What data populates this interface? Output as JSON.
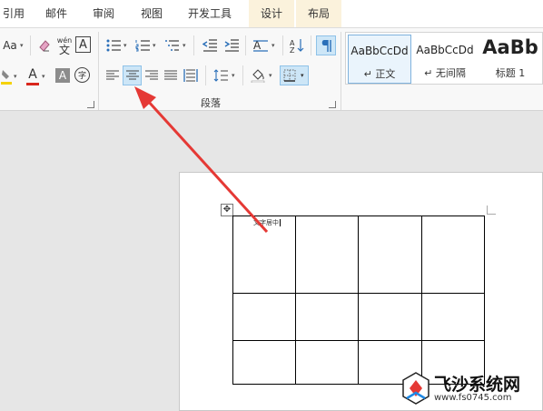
{
  "tabs": [
    {
      "label": "引用"
    },
    {
      "label": "邮件"
    },
    {
      "label": "审阅"
    },
    {
      "label": "视图"
    },
    {
      "label": "开发工具"
    },
    {
      "label": "设计"
    },
    {
      "label": "布局"
    }
  ],
  "ribbon": {
    "font": {
      "change_case_label": "Aa",
      "phonetic_top": "wén",
      "phonetic_bottom": "文",
      "border_char": "A",
      "font_color_label": "A",
      "shading_char": "A",
      "enclose_char": "字"
    },
    "paragraph": {
      "group_label": "段落",
      "align_center_selected": true
    },
    "styles": {
      "items": [
        {
          "sample": "AaBbCcDd",
          "name": "↵ 正文"
        },
        {
          "sample": "AaBbCcDd",
          "name": "↵ 无间隔"
        },
        {
          "sample": "AaBb",
          "name": "标题 1"
        }
      ]
    }
  },
  "document": {
    "cell_text": "文字居中",
    "move_handle": "✥"
  },
  "watermark": {
    "title": "飞沙系统网",
    "url": "www.fs0745.com"
  },
  "colors": {
    "arrow": "#e53935",
    "highlight": "#f5d20a",
    "font_color": "#d9261c",
    "selected_button": "#cde6f7"
  }
}
